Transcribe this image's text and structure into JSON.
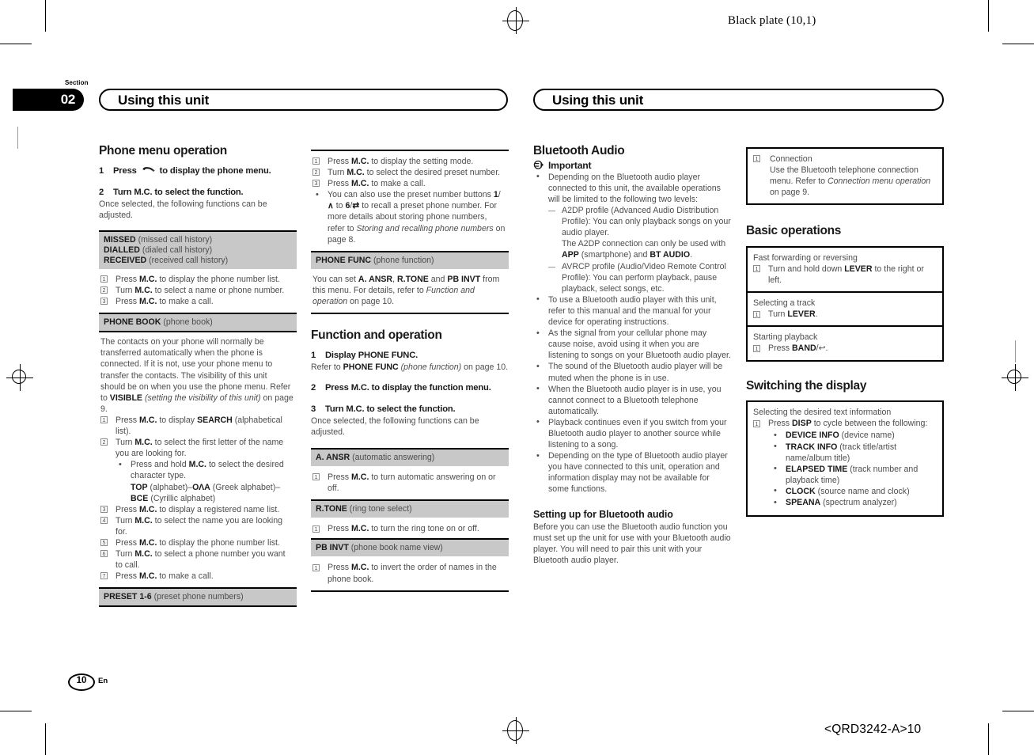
{
  "print_marks": {
    "black_plate": "Black plate (10,1)",
    "plate_code": "<QRD3242-A>10"
  },
  "section": {
    "label": "Section",
    "number": "02"
  },
  "left_page": {
    "chapter_title": "Using this unit",
    "column1": {
      "heading": "Phone menu operation",
      "step1_num": "1",
      "step1_text_a": "Press",
      "step1_text_b": "to display the phone menu.",
      "step2_num": "2",
      "step2_text": "Turn M.C. to select the function.",
      "step2_after": "Once selected, the following functions can be adjusted.",
      "band1_rows": [
        {
          "code": "MISSED",
          "desc": "(missed call history)"
        },
        {
          "code": "DIALLED",
          "desc": "(dialed call history)"
        },
        {
          "code": "RECEIVED",
          "desc": "(received call history)"
        }
      ],
      "band1_steps": [
        "Press M.C. to display the phone number list.",
        "Turn M.C. to select a name or phone number.",
        "Press M.C. to make a call."
      ],
      "band2_code": "PHONE BOOK",
      "band2_desc": "(phone book)",
      "band2_para": "The contacts on your phone will normally be transferred automatically when the phone is connected. If it is not, use your phone menu to transfer the contacts. The visibility of this unit should be on when you use the phone menu. Refer to VISIBLE (setting the visibility of this unit) on page 9.",
      "band2_ref_bold": "VISIBLE",
      "band2_ref_italic": "(setting the visibility of this unit)",
      "band2_steps": [
        "Press M.C. to display SEARCH (alphabetical list).",
        "Turn M.C. to select the first letter of the name you are looking for.",
        "Press M.C. to display a registered name list.",
        "Turn M.C. to select the name you are looking for.",
        "Press M.C. to display the phone number list.",
        "Turn M.C. to select a phone number you want to call.",
        "Press M.C. to make a call."
      ],
      "band2_substep": "Press and hold M.C. to select the desired character type.",
      "band2_charsets": "TOP (alphabet)–ΟΛΑ (Greek alphabet)–BCE (Cyrillic alphabet)",
      "band3_code": "PRESET 1-6",
      "band3_desc": "(preset phone numbers)"
    },
    "column2": {
      "top_steps": [
        "Press M.C. to display the setting mode.",
        "Turn M.C. to select the desired preset number.",
        "Press M.C. to make a call."
      ],
      "top_bullet": "You can also use the preset number buttons 1/∧ to 6/⇄ to recall a preset phone number. For more details about storing phone numbers, refer to Storing and recalling phone numbers on page 8.",
      "top_bullet_italic": "Storing and recalling phone numbers",
      "band_phonefunc_code": "PHONE FUNC",
      "band_phonefunc_desc": "(phone function)",
      "band_phonefunc_para": "You can set A. ANSR, R.TONE and PB INVT from this menu. For details, refer to Function and operation on page 10.",
      "band_phonefunc_italic": "Function and operation",
      "heading2": "Function and operation",
      "step1_num": "1",
      "step1_text": "Display PHONE FUNC.",
      "step1_after": "Refer to PHONE FUNC (phone function) on page 10.",
      "step1_after_bold": "PHONE FUNC",
      "step1_after_italic": "(phone function)",
      "step2_num": "2",
      "step2_text": "Press M.C. to display the function menu.",
      "step3_num": "3",
      "step3_text": "Turn M.C. to select the function.",
      "step3_after": "Once selected, the following functions can be adjusted.",
      "func_bands": [
        {
          "code": "A. ANSR",
          "desc": "(automatic answering)",
          "steps": [
            "Press M.C. to turn automatic answering on or off."
          ]
        },
        {
          "code": "R.TONE",
          "desc": "(ring tone select)",
          "steps": [
            "Press M.C. to turn the ring tone on or off."
          ]
        },
        {
          "code": "PB INVT",
          "desc": "(phone book name view)",
          "steps": [
            "Press M.C. to invert the order of names in the phone book."
          ]
        }
      ]
    },
    "page_number": "10",
    "page_lang": "En"
  },
  "right_page": {
    "chapter_title": "Using this unit",
    "column3": {
      "heading": "Bluetooth Audio",
      "important_label": "Important",
      "bullets": [
        "Depending on the Bluetooth audio player connected to this unit, the available operations will be limited to the following two levels:",
        "To use a Bluetooth audio player with this unit, refer to this manual and the manual for your device for operating instructions.",
        "As the signal from your cellular phone may cause noise, avoid using it when you are listening to songs on your Bluetooth audio player.",
        "The sound of the Bluetooth audio player will be muted when the phone is in use.",
        "When the Bluetooth audio player is in use, you cannot connect to a Bluetooth telephone automatically.",
        "Playback continues even if you switch from your Bluetooth audio player to another source while listening to a song.",
        "Depending on the type of Bluetooth audio player you have connected to this unit, operation and information display may not be available for some functions."
      ],
      "dash_items": [
        "A2DP profile (Advanced Audio Distribution Profile): You can only playback songs on your audio player.",
        "AVRCP profile (Audio/Video Remote Control Profile): You can perform playback, pause playback, select songs, etc."
      ],
      "a2dp_note": "The A2DP connection can only be used with APP (smartphone) and BT AUDIO.",
      "a2dp_note_bold1": "APP",
      "a2dp_note_bold2": "BT AUDIO",
      "subheading": "Setting up for Bluetooth audio",
      "sub_para": "Before you can use the Bluetooth audio function you must set up the unit for use with your Bluetooth audio player. You will need to pair this unit with your Bluetooth audio player."
    },
    "column4": {
      "conn_box": {
        "num": "1",
        "title": "Connection",
        "text": "Use the Bluetooth telephone connection menu. Refer to Connection menu operation on page 9.",
        "italic": "Connection menu operation"
      },
      "basic_heading": "Basic operations",
      "basic_rows": [
        {
          "caption": "Fast forwarding or reversing",
          "step": "Turn and hold down LEVER to the right or left.",
          "bold": "LEVER"
        },
        {
          "caption": "Selecting a track",
          "step": "Turn LEVER.",
          "bold": "LEVER"
        },
        {
          "caption": "Starting playback",
          "step": "Press BAND/↩.",
          "bold": "BAND"
        }
      ],
      "switch_heading": "Switching the display",
      "switch_caption": "Selecting the desired text information",
      "switch_step": "Press DISP to cycle between the following:",
      "switch_step_bold": "DISP",
      "switch_items": [
        {
          "code": "DEVICE INFO",
          "desc": "(device name)"
        },
        {
          "code": "TRACK INFO",
          "desc": "(track title/artist name/album title)"
        },
        {
          "code": "ELAPSED TIME",
          "desc": "(track number and playback time)"
        },
        {
          "code": "CLOCK",
          "desc": "(source name and clock)"
        },
        {
          "code": "SPEANA",
          "desc": "(spectrum analyzer)"
        }
      ]
    }
  }
}
